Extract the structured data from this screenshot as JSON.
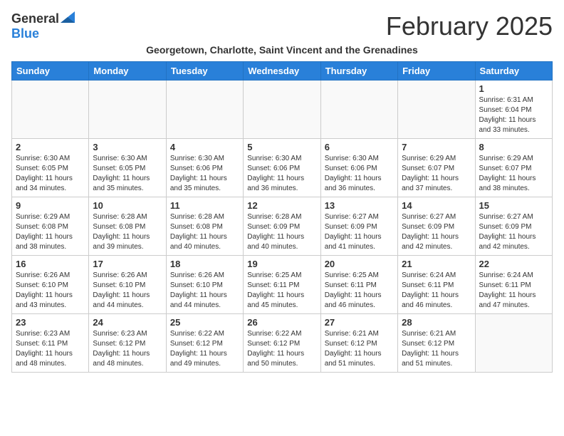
{
  "header": {
    "logo_general": "General",
    "logo_blue": "Blue",
    "month_title": "February 2025",
    "subtitle": "Georgetown, Charlotte, Saint Vincent and the Grenadines"
  },
  "weekdays": [
    "Sunday",
    "Monday",
    "Tuesday",
    "Wednesday",
    "Thursday",
    "Friday",
    "Saturday"
  ],
  "weeks": [
    [
      {
        "day": "",
        "info": ""
      },
      {
        "day": "",
        "info": ""
      },
      {
        "day": "",
        "info": ""
      },
      {
        "day": "",
        "info": ""
      },
      {
        "day": "",
        "info": ""
      },
      {
        "day": "",
        "info": ""
      },
      {
        "day": "1",
        "info": "Sunrise: 6:31 AM\nSunset: 6:04 PM\nDaylight: 11 hours\nand 33 minutes."
      }
    ],
    [
      {
        "day": "2",
        "info": "Sunrise: 6:30 AM\nSunset: 6:05 PM\nDaylight: 11 hours\nand 34 minutes."
      },
      {
        "day": "3",
        "info": "Sunrise: 6:30 AM\nSunset: 6:05 PM\nDaylight: 11 hours\nand 35 minutes."
      },
      {
        "day": "4",
        "info": "Sunrise: 6:30 AM\nSunset: 6:06 PM\nDaylight: 11 hours\nand 35 minutes."
      },
      {
        "day": "5",
        "info": "Sunrise: 6:30 AM\nSunset: 6:06 PM\nDaylight: 11 hours\nand 36 minutes."
      },
      {
        "day": "6",
        "info": "Sunrise: 6:30 AM\nSunset: 6:06 PM\nDaylight: 11 hours\nand 36 minutes."
      },
      {
        "day": "7",
        "info": "Sunrise: 6:29 AM\nSunset: 6:07 PM\nDaylight: 11 hours\nand 37 minutes."
      },
      {
        "day": "8",
        "info": "Sunrise: 6:29 AM\nSunset: 6:07 PM\nDaylight: 11 hours\nand 38 minutes."
      }
    ],
    [
      {
        "day": "9",
        "info": "Sunrise: 6:29 AM\nSunset: 6:08 PM\nDaylight: 11 hours\nand 38 minutes."
      },
      {
        "day": "10",
        "info": "Sunrise: 6:28 AM\nSunset: 6:08 PM\nDaylight: 11 hours\nand 39 minutes."
      },
      {
        "day": "11",
        "info": "Sunrise: 6:28 AM\nSunset: 6:08 PM\nDaylight: 11 hours\nand 40 minutes."
      },
      {
        "day": "12",
        "info": "Sunrise: 6:28 AM\nSunset: 6:09 PM\nDaylight: 11 hours\nand 40 minutes."
      },
      {
        "day": "13",
        "info": "Sunrise: 6:27 AM\nSunset: 6:09 PM\nDaylight: 11 hours\nand 41 minutes."
      },
      {
        "day": "14",
        "info": "Sunrise: 6:27 AM\nSunset: 6:09 PM\nDaylight: 11 hours\nand 42 minutes."
      },
      {
        "day": "15",
        "info": "Sunrise: 6:27 AM\nSunset: 6:09 PM\nDaylight: 11 hours\nand 42 minutes."
      }
    ],
    [
      {
        "day": "16",
        "info": "Sunrise: 6:26 AM\nSunset: 6:10 PM\nDaylight: 11 hours\nand 43 minutes."
      },
      {
        "day": "17",
        "info": "Sunrise: 6:26 AM\nSunset: 6:10 PM\nDaylight: 11 hours\nand 44 minutes."
      },
      {
        "day": "18",
        "info": "Sunrise: 6:26 AM\nSunset: 6:10 PM\nDaylight: 11 hours\nand 44 minutes."
      },
      {
        "day": "19",
        "info": "Sunrise: 6:25 AM\nSunset: 6:11 PM\nDaylight: 11 hours\nand 45 minutes."
      },
      {
        "day": "20",
        "info": "Sunrise: 6:25 AM\nSunset: 6:11 PM\nDaylight: 11 hours\nand 46 minutes."
      },
      {
        "day": "21",
        "info": "Sunrise: 6:24 AM\nSunset: 6:11 PM\nDaylight: 11 hours\nand 46 minutes."
      },
      {
        "day": "22",
        "info": "Sunrise: 6:24 AM\nSunset: 6:11 PM\nDaylight: 11 hours\nand 47 minutes."
      }
    ],
    [
      {
        "day": "23",
        "info": "Sunrise: 6:23 AM\nSunset: 6:11 PM\nDaylight: 11 hours\nand 48 minutes."
      },
      {
        "day": "24",
        "info": "Sunrise: 6:23 AM\nSunset: 6:12 PM\nDaylight: 11 hours\nand 48 minutes."
      },
      {
        "day": "25",
        "info": "Sunrise: 6:22 AM\nSunset: 6:12 PM\nDaylight: 11 hours\nand 49 minutes."
      },
      {
        "day": "26",
        "info": "Sunrise: 6:22 AM\nSunset: 6:12 PM\nDaylight: 11 hours\nand 50 minutes."
      },
      {
        "day": "27",
        "info": "Sunrise: 6:21 AM\nSunset: 6:12 PM\nDaylight: 11 hours\nand 51 minutes."
      },
      {
        "day": "28",
        "info": "Sunrise: 6:21 AM\nSunset: 6:12 PM\nDaylight: 11 hours\nand 51 minutes."
      },
      {
        "day": "",
        "info": ""
      }
    ]
  ]
}
